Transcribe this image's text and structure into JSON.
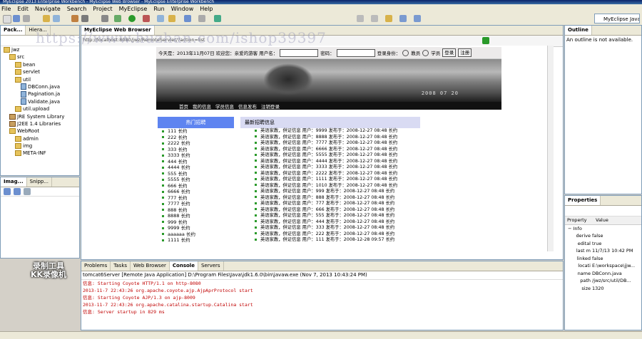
{
  "window": {
    "title": "MyEclipse 2013 Enterprise Workbench - MyEclipse Web Browser - MyEclipse Enterprise Workbench"
  },
  "menu": [
    "File",
    "Edit",
    "Navigate",
    "Search",
    "Project",
    "MyEclipse",
    "Run",
    "Window",
    "Help"
  ],
  "perspective": "MyEclipse Java",
  "left_tabs": [
    {
      "label": "Pack...",
      "active": true
    },
    {
      "label": "Hiera..."
    }
  ],
  "tree": [
    {
      "label": "jwz",
      "indent": 0,
      "icon": "project"
    },
    {
      "label": "src",
      "indent": 1,
      "icon": "folder"
    },
    {
      "label": "bean",
      "indent": 2,
      "icon": "folder"
    },
    {
      "label": "servlet",
      "indent": 2,
      "icon": "folder"
    },
    {
      "label": "util",
      "indent": 2,
      "icon": "folder"
    },
    {
      "label": "DBConn.java",
      "indent": 3,
      "icon": "java"
    },
    {
      "label": "Pagination.ja",
      "indent": 3,
      "icon": "java"
    },
    {
      "label": "Validate.java",
      "indent": 3,
      "icon": "java"
    },
    {
      "label": "util.upload",
      "indent": 2,
      "icon": "folder"
    },
    {
      "label": "JRE System Library",
      "indent": 1,
      "icon": "jar"
    },
    {
      "label": "J2EE 1.4 Libraries",
      "indent": 1,
      "icon": "jar"
    },
    {
      "label": "WebRoot",
      "indent": 1,
      "icon": "folder"
    },
    {
      "label": "admin",
      "indent": 2,
      "icon": "folder"
    },
    {
      "label": "img",
      "indent": 2,
      "icon": "folder"
    },
    {
      "label": "META-INF",
      "indent": 2,
      "icon": "folder"
    }
  ],
  "left_bottom_tabs": [
    {
      "label": "Imag...",
      "active": true
    },
    {
      "label": "Snipp..."
    }
  ],
  "browser": {
    "tab": "MyEclipse Web Browser",
    "url": "http://localhost:8080/jwz/RemoteServlet/?action=list",
    "site": {
      "login": {
        "today": "今天是：2013年11月07日 欢迎您：亲爱的游客 用户名：",
        "password_label": "密码：",
        "role_label": "登录身份：",
        "role1": "教员",
        "role2": "学员",
        "login_btn": "登录",
        "register_btn": "注册"
      },
      "banner_date": "2008 07 20",
      "nav": [
        "首页",
        "我的信息",
        "学员信息",
        "信息发布",
        "注销登录"
      ],
      "left_header": "热门招聘",
      "left_items": [
        "111  长约",
        "222  长约",
        "2222  长约",
        "333  长约",
        "3333  长约",
        "444  长约",
        "4444  长约",
        "555  长约",
        "5555  长约",
        "666  长约",
        "6666  长约",
        "777  长约",
        "7777  长约",
        "888  长约",
        "8888  长约",
        "999  长约",
        "9999  长约",
        "aaaaaa  长约",
        "1111  长约"
      ],
      "right_header": "最新招聘信息",
      "right_items": [
        "英语家教，供证信息  用户：9999  发布于：2008-12-27 08:48  长约",
        "英语家教，供证信息  用户：8888  发布于：2008-12-27 08:48  长约",
        "英语家教，供证信息  用户：7777  发布于：2008-12-27 08:48  长约",
        "英语家教，供证信息  用户：6666  发布于：2008-12-27 08:48  长约",
        "英语家教，供证信息  用户：5555  发布于：2008-12-27 08:48  长约",
        "英语家教，供证信息  用户：4444  发布于：2008-12-27 08:48  长约",
        "英语家教，供证信息  用户：3333  发布于：2008-12-27 08:48  长约",
        "英语家教，供证信息  用户：2222  发布于：2008-12-27 08:48  长约",
        "英语家教，供证信息  用户：1111  发布于：2008-12-27 08:48  长约",
        "英语家教，供证信息  用户：1010  发布于：2008-12-27 08:48  长约",
        "英语家教，供证信息  用户：999  发布于：2008-12-27 08:48  长约",
        "英语家教，供证信息  用户：888  发布于：2008-12-27 08:48  长约",
        "英语家教，供证信息  用户：777  发布于：2008-12-27 08:48  长约",
        "英语家教，供证信息  用户：666  发布于：2008-12-27 08:48  长约",
        "英语家教，供证信息  用户：555  发布于：2008-12-27 08:48  长约",
        "英语家教，供证信息  用户：444  发布于：2008-12-27 08:48  长约",
        "英语家教，供证信息  用户：333  发布于：2008-12-27 08:48  长约",
        "英语家教，供证信息  用户：222  发布于：2008-12-27 08:48  长约",
        "英语家教，供证信息  用户：111  发布于：2008-12-28 09:57  长约"
      ]
    }
  },
  "outline": {
    "tab": "Outline",
    "message": "An outline is not available."
  },
  "properties": {
    "tab": "Properties",
    "col_property": "Property",
    "col_value": "Value",
    "group": "Info",
    "rows": [
      {
        "k": "derive",
        "v": "false"
      },
      {
        "k": "edital",
        "v": "true"
      },
      {
        "k": "last m",
        "v": "11/7/13 10:42 PM"
      },
      {
        "k": "linked",
        "v": "false"
      },
      {
        "k": "locati",
        "v": "E:\\workspace\\jjw..."
      },
      {
        "k": "name",
        "v": "DBConn.java"
      },
      {
        "k": "path",
        "v": "/jwz/src/util/DB..."
      },
      {
        "k": "size",
        "v": "1320"
      }
    ]
  },
  "console": {
    "tabs": [
      {
        "label": "Problems"
      },
      {
        "label": "Tasks"
      },
      {
        "label": "Web Browser"
      },
      {
        "label": "Console",
        "active": true
      },
      {
        "label": "Servers"
      }
    ],
    "header": "tomcat6Server [Remote Java Application] D:\\Program Files\\Java\\jdk1.6.0\\bin\\javaw.exe (Nov 7, 2013 10:43:24 PM)",
    "lines": [
      "信息: Starting Coyote HTTP/1.1 on http-8080",
      "2013-11-7 22:43:26 org.apache.coyote.ajp.AjpAprProtocol start",
      "信息: Starting Coyote AJP/1.3 on ajp-8009",
      "2013-11-7 22:43:26 org.apache.catalina.startup.Catalina start",
      "信息: Server startup in 829 ms"
    ]
  },
  "overlay": {
    "watermark": "https://www.huzhan.com/ishop39397",
    "recorder_line1": "录制工具",
    "recorder_line2": "KK录像机"
  },
  "colors": {
    "accent": "#5e84f0",
    "console_text": "#c00000",
    "list_dot": "#2b9a2b"
  }
}
